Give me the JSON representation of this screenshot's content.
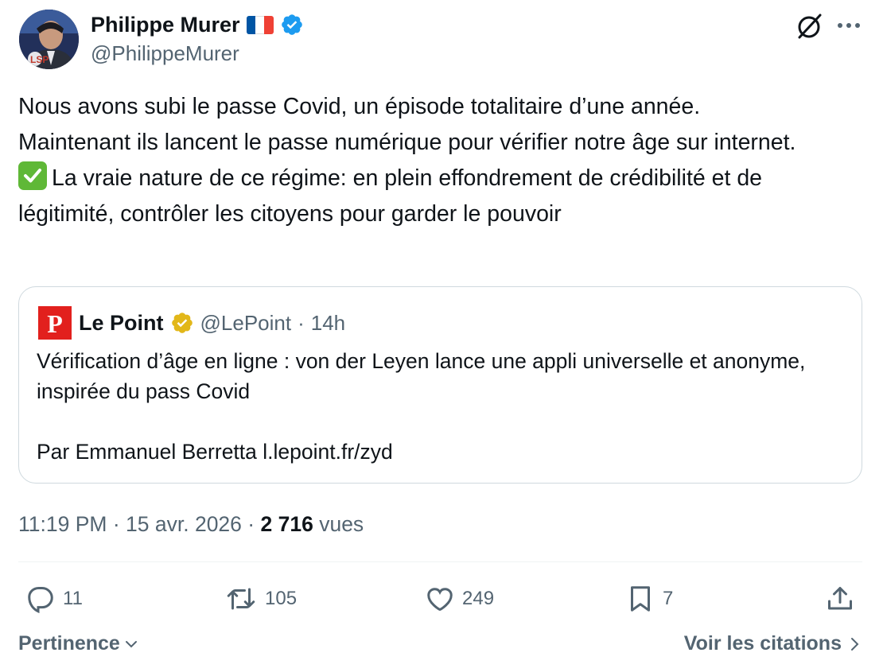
{
  "author": {
    "display_name": "Philippe Murer",
    "handle": "@PhilippeMurer",
    "flag_colors": [
      "#0055a4",
      "#ffffff",
      "#ef4135"
    ],
    "verified_color": "#1d9bf0"
  },
  "tweet": {
    "line1": "Nous avons subi le passe Covid, un épisode totalitaire d’une année.",
    "line2": "Maintenant ils lancent le passe numérique pour vérifier notre âge sur internet.",
    "line3": "La vraie nature de ce régime: en plein effondrement de crédibilité et de légitimité, contrôler les citoyens pour garder le pouvoir",
    "emoji": "check-mark-button"
  },
  "quote": {
    "logo_letter": "P",
    "name": "Le Point",
    "handle": "@LePoint",
    "separator": "·",
    "age": "14h",
    "text": "Vérification d’âge en ligne : von der Leyen lance une appli universelle et anonyme, inspirée du pass Covid\n\nPar Emmanuel Berretta l.lepoint.fr/zyd",
    "verified_color": "#e2b719"
  },
  "meta": {
    "time": "11:19 PM",
    "dot": "·",
    "date": "15 avr. 2026",
    "views_count": "2 716",
    "views_label": "vues"
  },
  "actions": {
    "replies": "11",
    "reposts": "105",
    "likes": "249",
    "bookmarks": "7"
  },
  "footer": {
    "sort_label": "Pertinence",
    "quotes_label": "Voir les citations"
  }
}
